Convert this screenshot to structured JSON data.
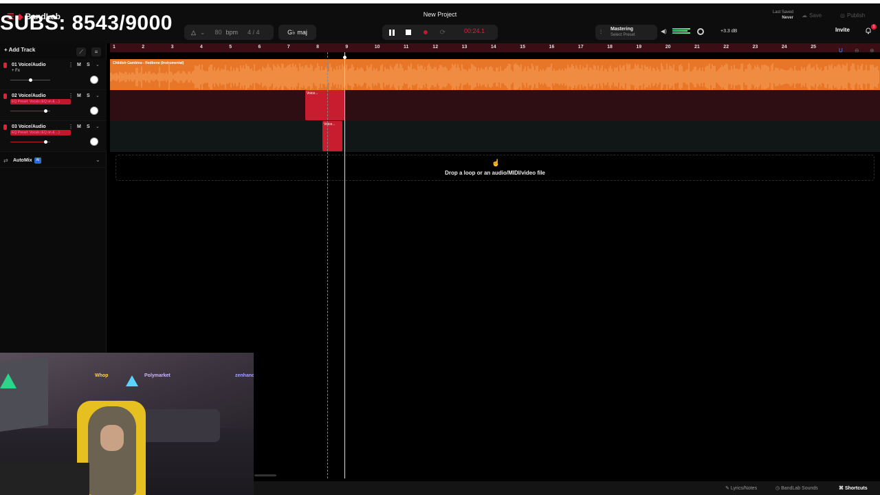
{
  "overlay": {
    "subs": "SUBS: 8543/9000"
  },
  "app": {
    "logo": "BandLab",
    "project_title": "New Project"
  },
  "toolbar": {
    "bpm_value": "80",
    "bpm_unit": "bpm",
    "time_signature": "4 / 4",
    "key": "maj",
    "time_display": "00:24.1",
    "mastering_label": "Mastering",
    "mastering_preset": "Select Preset",
    "volume_db": "+3.3 dB",
    "last_saved_label": "Last Saved",
    "last_saved_value": "Never",
    "save_label": "Save",
    "publish_label": "Publish",
    "invite_label": "Invite",
    "notification_count": "1"
  },
  "sidebar": {
    "add_track_label": "Add Track",
    "tracks": [
      {
        "name": "01 Voice/Audio",
        "fx": "+ Fx",
        "m": "M",
        "s": "S"
      },
      {
        "name": "02 Voice/Audio",
        "fx": "EQ Preset: Vocals (EQ on & ...)",
        "m": "M",
        "s": "S"
      },
      {
        "name": "03 Voice/Audio",
        "fx": "EQ Preset: Vocals (EQ on & ...)",
        "m": "M",
        "s": "S"
      }
    ],
    "automix_label": "AutoMix",
    "automix_badge": "AI"
  },
  "ruler": {
    "bars": [
      "1",
      "2",
      "3",
      "4",
      "5",
      "6",
      "7",
      "8",
      "9",
      "10",
      "11",
      "12",
      "13",
      "14",
      "15",
      "16",
      "17",
      "18",
      "19",
      "20",
      "21",
      "22",
      "23",
      "24",
      "25"
    ]
  },
  "clips": {
    "track1_title": "Childish Gambino - Redbone (Instrumental)",
    "track2_title": "Voice...",
    "track3_title": "Voice..."
  },
  "dropzone": {
    "text": "Drop a loop or an audio/MIDI/video file"
  },
  "footer": {
    "lyrics": "Lyrics/Notes",
    "sounds": "BandLab Sounds",
    "shortcuts": "Shortcuts"
  },
  "webcam": {
    "sign_left": "Whop",
    "sign_mid": "Polymarket",
    "sign_right": "zenhancing"
  },
  "colors": {
    "accent": "#e0213a",
    "waveform": "#f07a2a",
    "lane1": "#e87628",
    "lane2": "#3b1217",
    "lane3": "#141c1a"
  }
}
